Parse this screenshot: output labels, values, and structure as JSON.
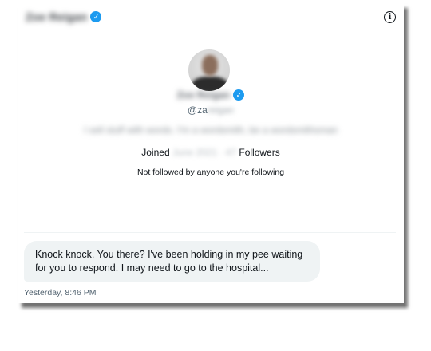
{
  "header": {
    "name": "Zoe Reigan",
    "verified": true
  },
  "profile": {
    "display_name": "Zoe Reigan",
    "handle_prefix": "@za",
    "handle_rest": "reigan",
    "bio": "I sell stuff with words. I'm a wordsmith, be a wordsmithsman",
    "joined_label": "Joined",
    "joined_value": "June 2021 · 47",
    "followers_label": "Followers",
    "not_followed_text": "Not followed by anyone you're following"
  },
  "messages": [
    {
      "text": "Knock knock. You there? I've been holding in my pee waiting for you to respond. I may need to go to the hospital...",
      "timestamp": "Yesterday, 8:46 PM"
    }
  ],
  "colors": {
    "verified_badge": "#1d9bf0",
    "bubble_bg": "#eff3f4",
    "text": "#0f1419",
    "muted": "#536471"
  },
  "icons": {
    "info": "info-icon",
    "verified": "verified-badge-icon"
  }
}
